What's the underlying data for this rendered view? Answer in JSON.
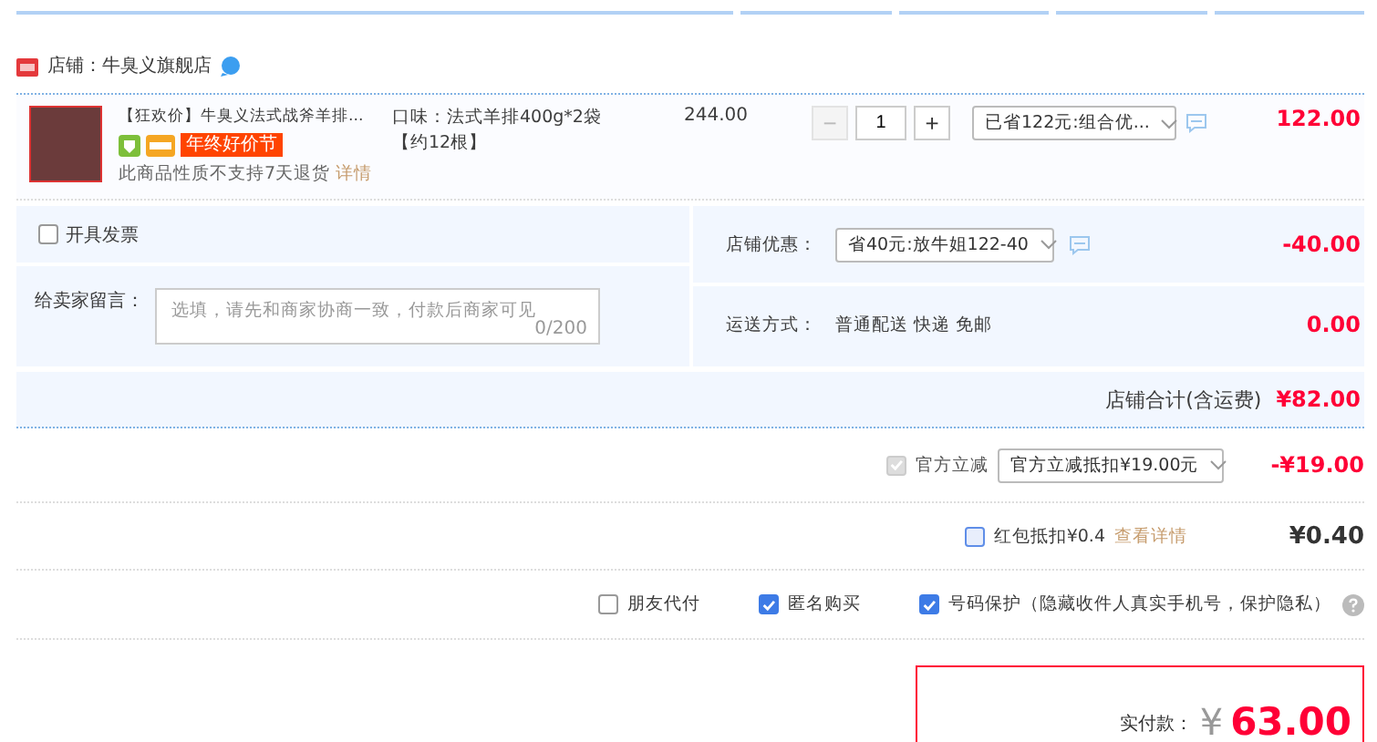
{
  "shop": {
    "label": "店铺：牛臭义旗舰店"
  },
  "item": {
    "title": "【狂欢价】牛臭义法式战斧羊排...",
    "badge": "年终好价节",
    "notice": "此商品性质不支持7天退货",
    "notice_link": "详情",
    "attribute": "口味：法式羊排400g*2袋【约12根】",
    "price": "244.00",
    "quantity": "1",
    "minus_disabled": true,
    "minus": "−",
    "plus": "+",
    "promo": "已省122元:组合优...",
    "subtotal": "122.00"
  },
  "invoice": {
    "label": "开具发票",
    "checked": false
  },
  "message": {
    "label": "给卖家留言：",
    "placeholder": "选填，请先和商家协商一致，付款后商家可见",
    "counter": "0/200"
  },
  "shop_discount": {
    "label": "店铺优惠：",
    "value": "省40元:放牛姐122-40",
    "amount": "-40.00"
  },
  "shipping": {
    "label": "运送方式：",
    "value": "普通配送 快递 免邮",
    "amount": "0.00"
  },
  "shop_total": {
    "label": "店铺合计(含运费)",
    "amount": "¥82.00"
  },
  "official_discount": {
    "label": "官方立减",
    "checked": true,
    "disabled": true,
    "value": "官方立减抵扣¥19.00元",
    "amount": "-¥19.00"
  },
  "red_packet": {
    "label": "红包抵扣¥0.4",
    "checked": false,
    "link": "查看详情",
    "amount": "¥0.40"
  },
  "options": [
    {
      "label": "朋友代付",
      "checked": false
    },
    {
      "label": "匿名购买",
      "checked": true
    },
    {
      "label": "号码保护（隐藏收件人真实手机号，保护隐私）",
      "checked": true
    }
  ],
  "payment": {
    "label": "实付款：",
    "currency": "¥",
    "amount": "63.00"
  }
}
